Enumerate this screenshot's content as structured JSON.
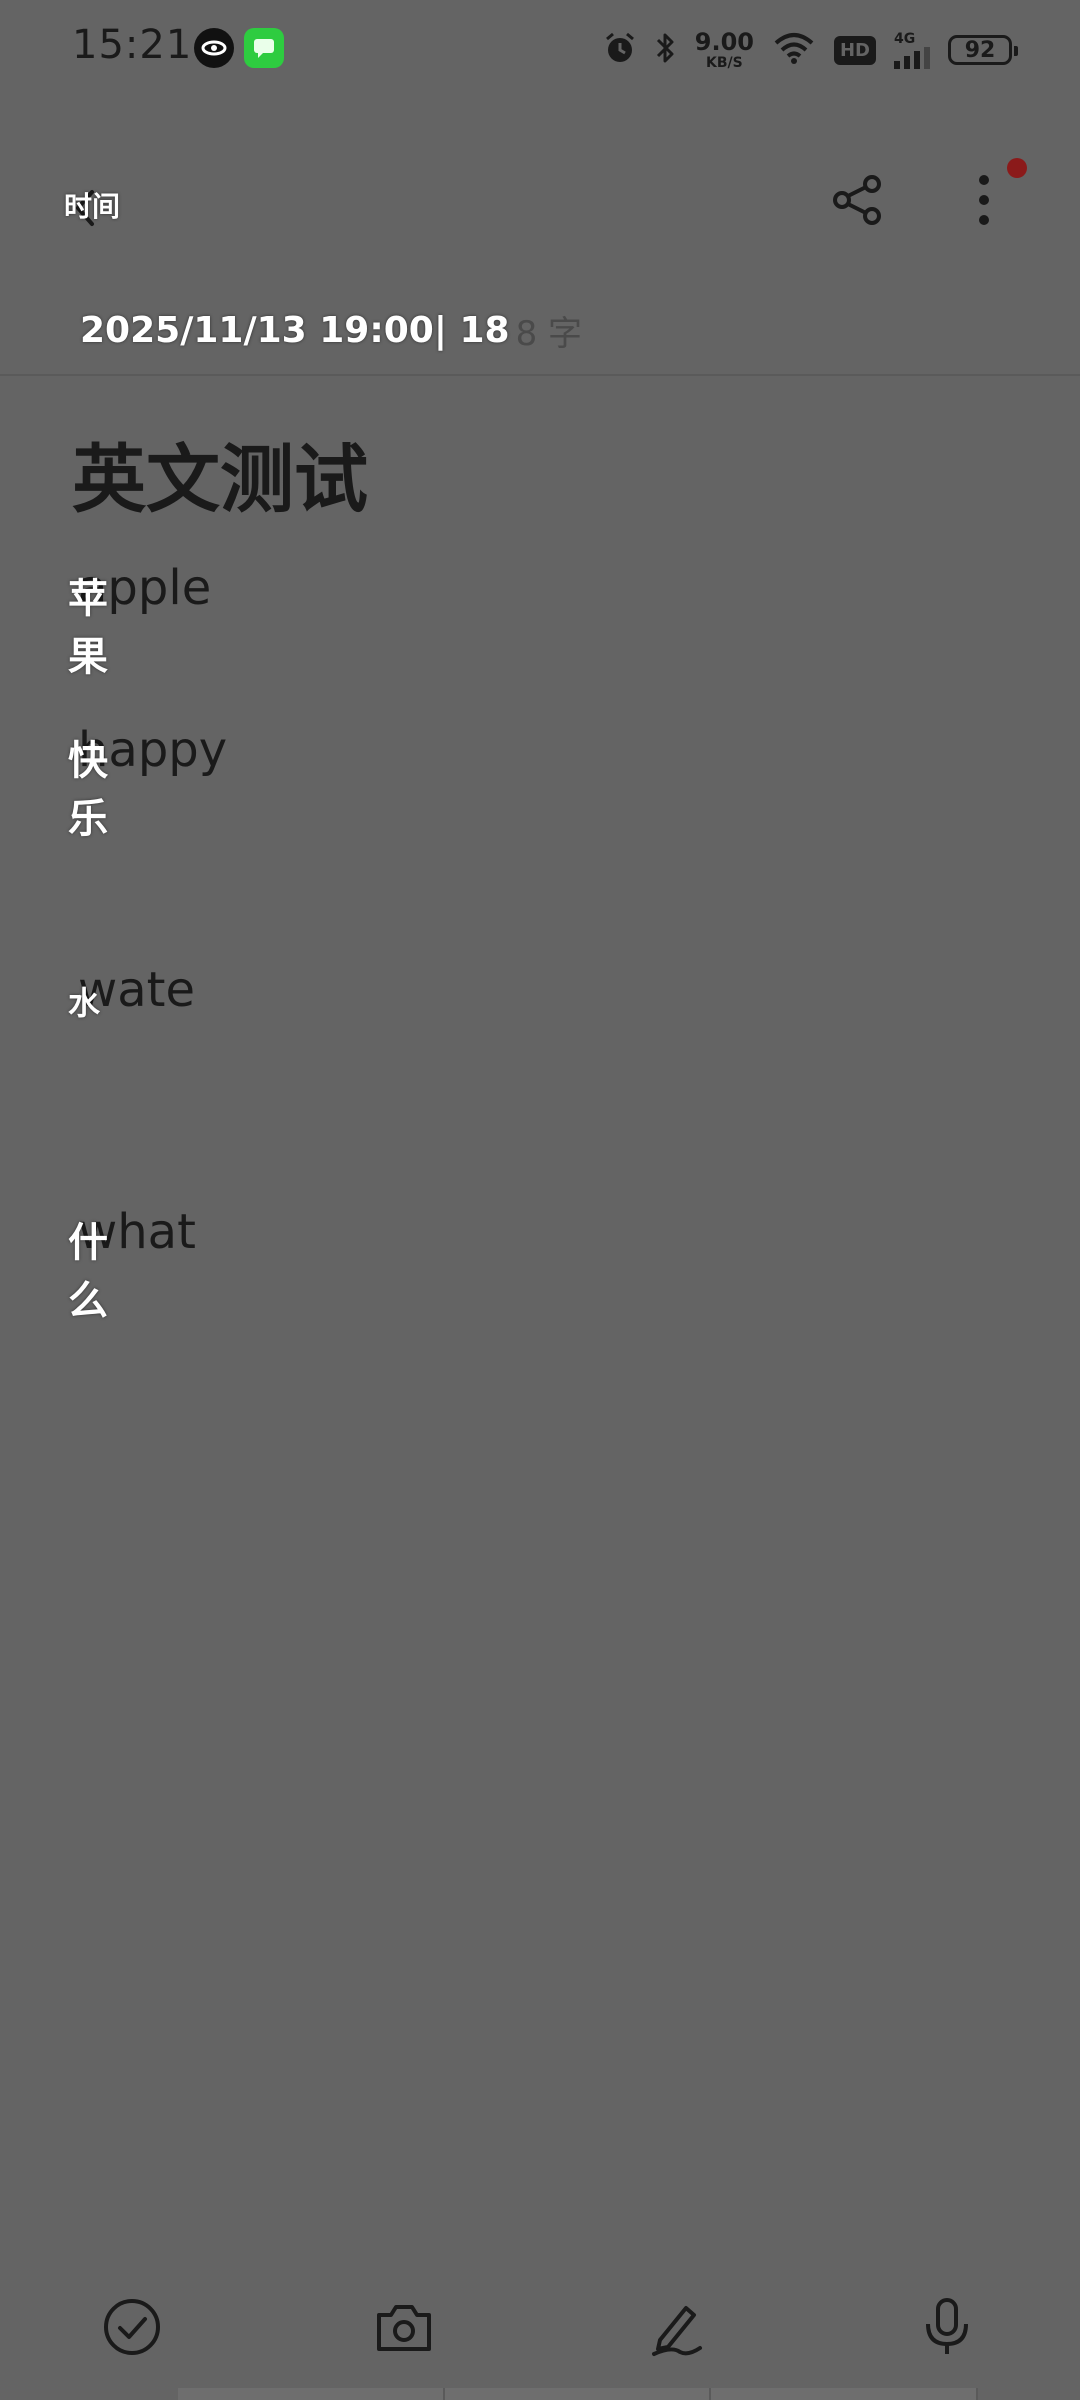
{
  "status_bar": {
    "time": "15:21",
    "network_speed_value": "9.00",
    "network_speed_unit": "KB/S",
    "hd": "HD",
    "cell_gen": "4G",
    "battery": "92"
  },
  "toolbar": {
    "time_label": "时间"
  },
  "meta": {
    "date_overlay": "2025/11/13 19:00| 18",
    "char_count_ghost": "8 字"
  },
  "note": {
    "title": "英文测试",
    "words": [
      {
        "english": "apple",
        "chinese": "苹果"
      },
      {
        "english": "happy",
        "chinese": "快乐"
      },
      {
        "english": "wate",
        "chinese": "水"
      },
      {
        "english": "what",
        "chinese": "什么"
      }
    ]
  },
  "colors": {
    "background": "#646464",
    "text_dark": "#1a1a1a",
    "overlay_text": "#ffffff",
    "notification_dot": "#8b1a1a"
  },
  "icons": {
    "back": "chevron-left-icon",
    "share": "share-icon",
    "more": "more-vertical-icon",
    "check": "check-circle-icon",
    "camera": "camera-icon",
    "pen": "pen-icon",
    "mic": "mic-icon"
  }
}
